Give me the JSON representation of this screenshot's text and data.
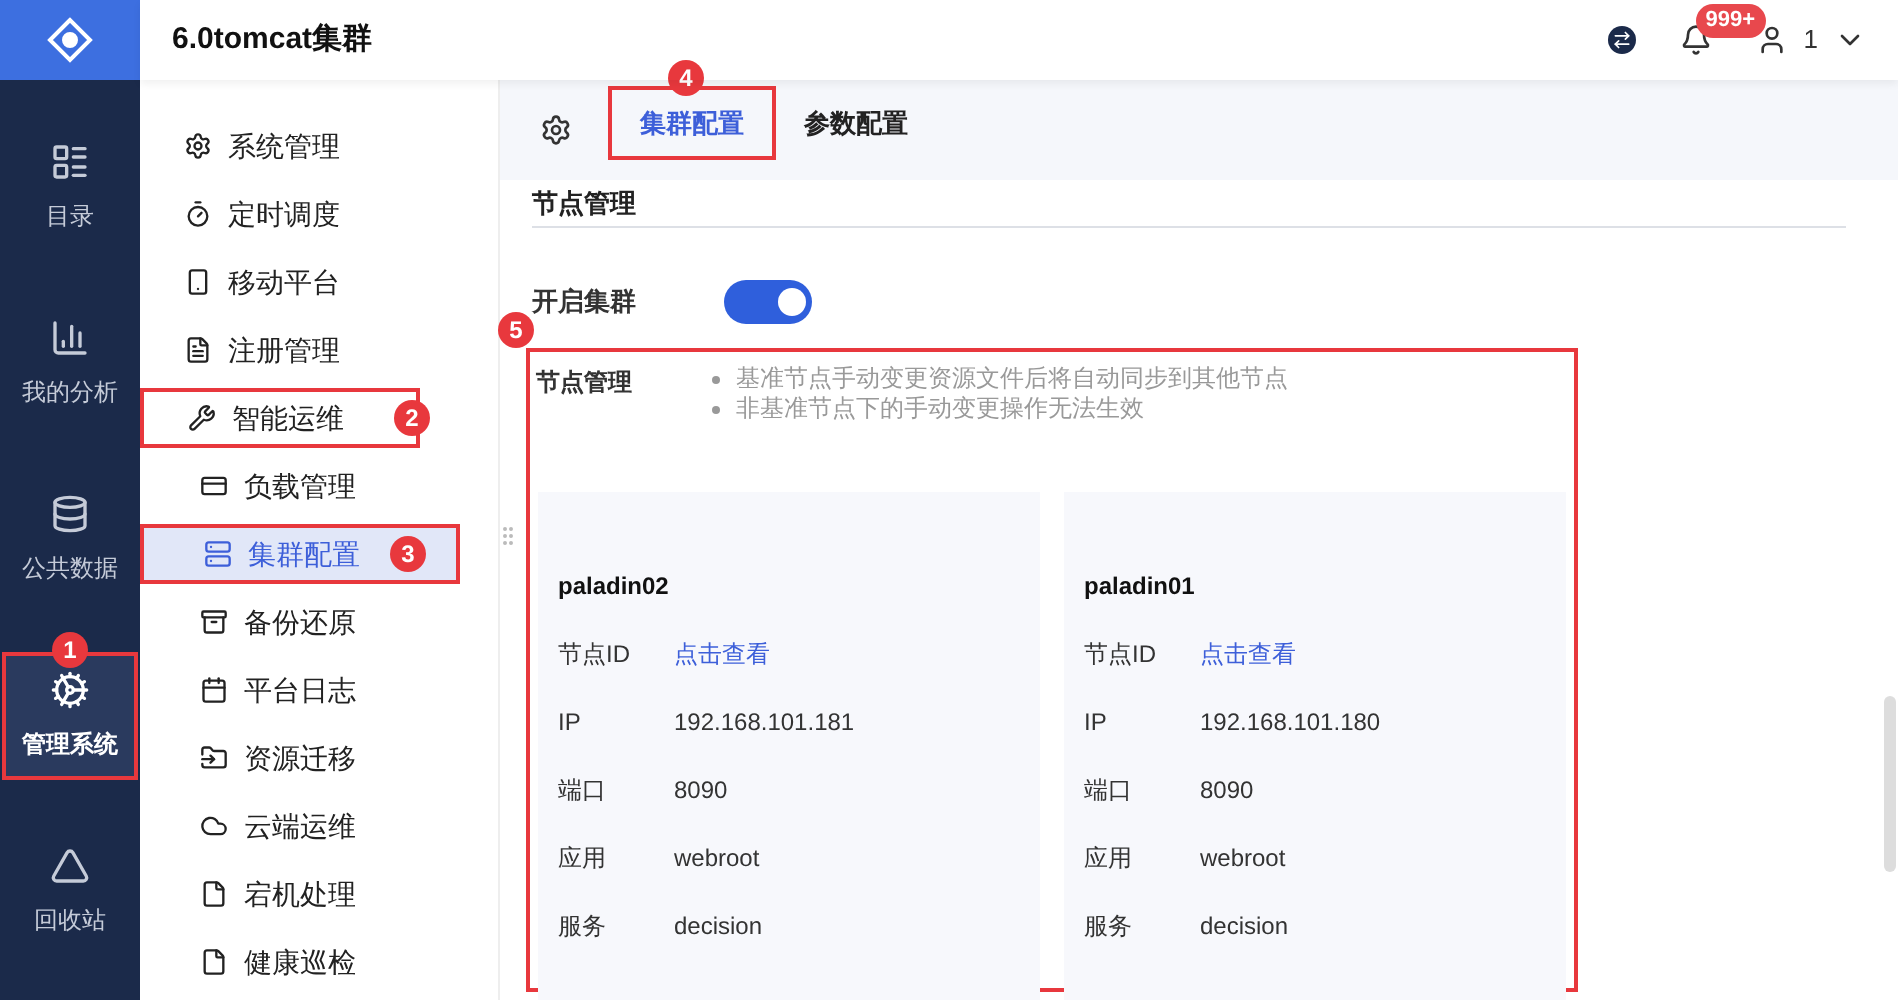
{
  "app_title": "6.0tomcat集群",
  "header": {
    "notification_badge": "999+",
    "user": "1"
  },
  "nav": [
    {
      "label": "目录",
      "selected": false
    },
    {
      "label": "我的分析",
      "selected": false
    },
    {
      "label": "公共数据",
      "selected": false
    },
    {
      "label": "管理系统",
      "selected": true,
      "annotation": "1"
    },
    {
      "label": "回收站",
      "selected": false
    }
  ],
  "menu": [
    {
      "label": "系统管理",
      "selected": false
    },
    {
      "label": "定时调度",
      "selected": false
    },
    {
      "label": "移动平台",
      "selected": false
    },
    {
      "label": "注册管理",
      "selected": false
    },
    {
      "label": "智能运维",
      "selected": false,
      "annotation": "2",
      "children": [
        {
          "label": "负载管理",
          "selected": false
        },
        {
          "label": "集群配置",
          "selected": true,
          "annotation": "3"
        },
        {
          "label": "备份还原",
          "selected": false
        },
        {
          "label": "平台日志",
          "selected": false
        },
        {
          "label": "资源迁移",
          "selected": false
        },
        {
          "label": "云端运维",
          "selected": false
        },
        {
          "label": "宕机处理",
          "selected": false
        },
        {
          "label": "健康巡检",
          "selected": false
        }
      ]
    }
  ],
  "tabs": [
    {
      "label": "集群配置",
      "selected": true,
      "annotation": "4"
    },
    {
      "label": "参数配置",
      "selected": false
    }
  ],
  "section_title": "节点管理",
  "cluster_toggle": {
    "label": "开启集群",
    "on": true
  },
  "node_management": {
    "label": "节点管理",
    "annotation": "5",
    "notes": [
      "基准节点手动变更资源文件后将自动同步到其他节点",
      "非基准节点下的手动变更操作无法生效"
    ],
    "nodes": [
      {
        "name": "paladin02",
        "fields": [
          {
            "label": "节点ID",
            "value": "点击查看",
            "kind": "link"
          },
          {
            "label": "IP",
            "value": "192.168.101.181",
            "kind": "text"
          },
          {
            "label": "端口",
            "value": "8090",
            "kind": "text"
          },
          {
            "label": "应用",
            "value": "webroot",
            "kind": "text"
          },
          {
            "label": "服务",
            "value": "decision",
            "kind": "text"
          }
        ]
      },
      {
        "name": "paladin01",
        "fields": [
          {
            "label": "节点ID",
            "value": "点击查看",
            "kind": "link"
          },
          {
            "label": "IP",
            "value": "192.168.101.180",
            "kind": "text"
          },
          {
            "label": "端口",
            "value": "8090",
            "kind": "text"
          },
          {
            "label": "应用",
            "value": "webroot",
            "kind": "text"
          },
          {
            "label": "服务",
            "value": "decision",
            "kind": "text"
          }
        ]
      }
    ]
  }
}
